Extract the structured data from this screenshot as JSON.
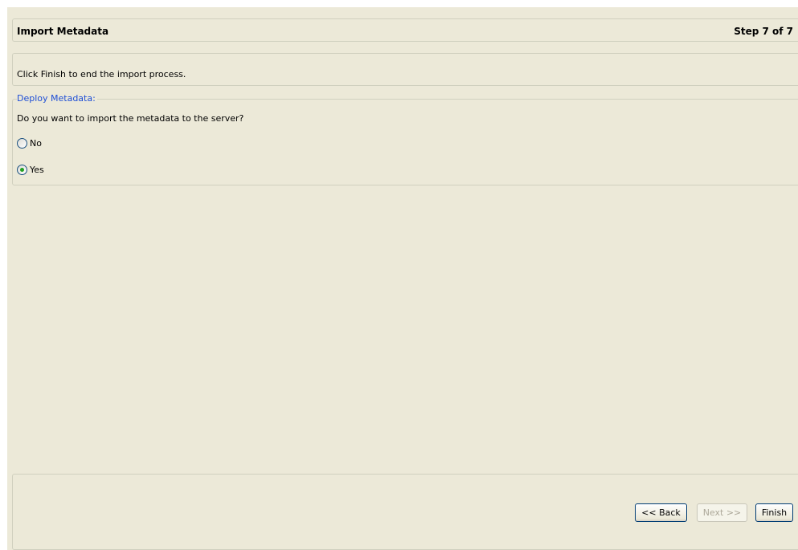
{
  "header": {
    "title": "Import Metadata",
    "step": "Step 7 of 7"
  },
  "instruction": {
    "text": "Click Finish to end the import process."
  },
  "deploy": {
    "legend": "Deploy Metadata:",
    "question": "Do you want to import the metadata to the server?",
    "options": [
      {
        "label": "No",
        "selected": false
      },
      {
        "label": "Yes",
        "selected": true
      }
    ]
  },
  "footer": {
    "back_label": "<< Back",
    "next_label": "Next >>",
    "finish_label": "Finish",
    "next_enabled": false
  },
  "colors": {
    "background": "#ece9d8",
    "legend": "#1f4fd6",
    "radio_dot": "#21a121"
  }
}
